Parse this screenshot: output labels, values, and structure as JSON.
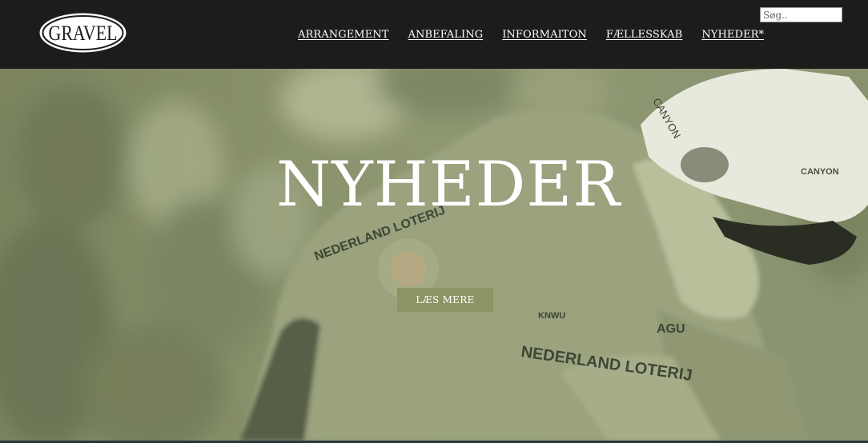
{
  "brand": {
    "logo_text": "GRAVEL",
    "logo_icon": "gravel-oval-logo"
  },
  "nav": {
    "items": [
      {
        "label": "ARRANGEMENT"
      },
      {
        "label": "ANBEFALING"
      },
      {
        "label": "INFORMAITON"
      },
      {
        "label": "FÆLLESSKAB"
      },
      {
        "label": "NYHEDER*"
      }
    ]
  },
  "search": {
    "placeholder": "Søg.."
  },
  "hero": {
    "title": "NYHEDER",
    "button_label": "LÆS MERE",
    "image": "cyclist-photo-green-tint",
    "photo_visible_text": [
      "CANYON",
      "CANYON",
      "NEDERLAND LOTERIJ",
      "NEDERLAND LOTERIJ",
      "AGU",
      "KNWU"
    ]
  },
  "colors": {
    "header_bg": "#1c1c1b",
    "hero_tint": "#8e9771",
    "button_bg": "#8d9463",
    "text": "#ffffff"
  }
}
